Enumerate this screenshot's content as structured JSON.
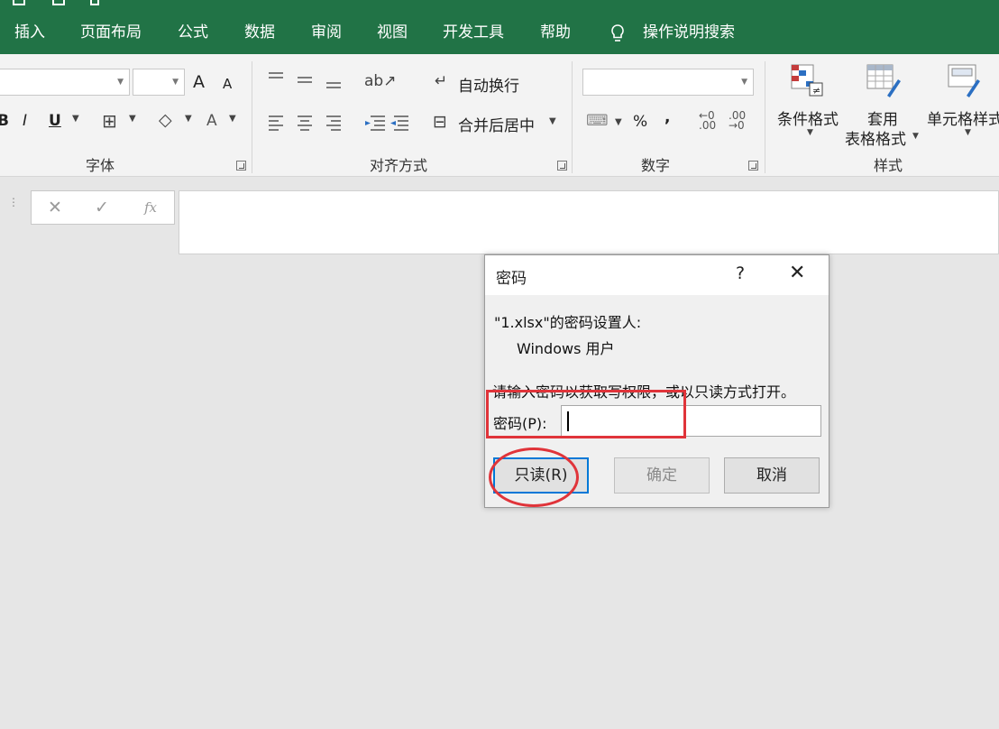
{
  "menu": {
    "tabs": [
      "插入",
      "页面布局",
      "公式",
      "数据",
      "审阅",
      "视图",
      "开发工具",
      "帮助"
    ],
    "search_label": "操作说明搜索"
  },
  "ribbon": {
    "font_group": {
      "label": "字体",
      "bold": "B",
      "italic": "I",
      "underline": "U",
      "grow": "A",
      "shrink": "A",
      "font_color": "A"
    },
    "align_group": {
      "label": "对齐方式",
      "wrap_text": "自动换行",
      "merge_center": "合并后居中"
    },
    "number_group": {
      "label": "数字",
      "percent": "%",
      "comma": ","
    },
    "styles_group": {
      "label": "样式",
      "conditional_format": "条件格式",
      "format_table_1": "套用",
      "format_table_2": "表格格式",
      "cell_styles": "单元格样式"
    }
  },
  "formula_bar": {
    "cancel": "✕",
    "enter": "✓",
    "fx": "fx"
  },
  "dialog": {
    "title": "密码",
    "help": "?",
    "close": "✕",
    "owner_line": "\"1.xlsx\"的密码设置人:",
    "owner_name": "Windows 用户",
    "instruction": "请输入密码以获取写权限，或以只读方式打开。",
    "password_label": "密码(P):",
    "password_value": "",
    "buttons": {
      "readonly": "只读(R)",
      "ok": "确定",
      "cancel": "取消"
    }
  },
  "colors": {
    "menu_bg": "#217346",
    "highlight": "#e0343a",
    "focus": "#0078d7"
  }
}
